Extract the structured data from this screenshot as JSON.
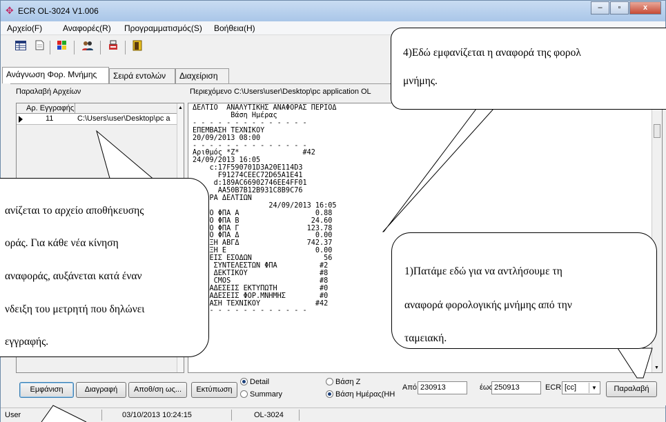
{
  "window": {
    "title": "ECR OL-3024 V1.006",
    "controls": [
      "–",
      "▫",
      "x"
    ]
  },
  "menu": [
    "Αρχείο(F)",
    "Αναφορές(R)",
    "Προγραμματισμός(S)",
    "Βοήθεια(H)"
  ],
  "tabs": [
    "Ανάγνωση Φορ. Μνήμης",
    "Σειρά εντολών",
    "Διαχείριση"
  ],
  "left": {
    "label": "Παραλαβή Αρχείων",
    "columns": [
      "Αρ. Εγγραφής",
      ""
    ],
    "rows": [
      {
        "num": "11",
        "path": "C:\\Users\\user\\Desktop\\pc a"
      }
    ]
  },
  "right": {
    "label": "Περιεχόμενο   C:\\Users\\user\\Desktop\\pc application OL",
    "report": "ΔΕΛΤΙΟ  ΑΝΑΛΥΤΙΚΗΣ ΑΝΑΦΟΡΑΣ ΠΕΡΙΟΔ\n         Βάση Ημέρας\n- - - - - - - - - - - - - -\nΕΠΕΜΒΑΣΗ ΤΕΧΝΙΚΟΥ\n20/09/2013 08:00\n- - - - - - - - - - - - - -\nΑριθμός *Ζ*               #42\n24/09/2013 16:05\n    c:17F590701D3A20E114D3\n      F91274CEEC72D65A1E41\n     d:189AC66902746EE4FF01\n      AA50B7B12B931C8B9C76\n   ΟΡΑ ΔΕΛΤΙΩΝ\n                  24/09/2013 16:05\n   ΤΟ ΦΠΑ Α                  0.88\n   ΤΟ ΦΠΑ Β                 24.60\n   ΤΟ ΦΠΑ Γ                123.78\n   ΤΟ ΦΠΑ Δ                  0.00\n   ΑΞΗ ΑΒΓΔ                742.37\n   ΑΞΗ Ε                     0.00\n   ΞΕΙΣ ΕΣΟΔΩΝ                 56\n   Η ΣΥΝΤΕΛΕΣΤΩΝ ΦΠΑ          #2\n   Η ΔΕΚΤΙΚΟΥ                 #8\n   Η CMOS                     #8\n   ΝΑΔΕΣΕΙΣ ΕΚΤΥΠΩΤΗ          #0\n   ΝΑΔΕΣΕΙΣ ΦΟΡ.ΜΝΗΜΗΣ        #0\n   ΒΑΣΗ ΤΕΧΝΙΚΟΥ             #42\n- - - - - - - - - - - - - -"
  },
  "bottom": {
    "show": "Εμφάνιση",
    "delete": "Διαγραφή",
    "save_as": "Αποθ/ση ως...",
    "print": "Εκτύπωση",
    "detail": "Detail",
    "summary": "Summary",
    "basis_z": "Βάση Ζ",
    "basis_day": "Βάση Ημέρας(ΗΗ",
    "from_label": "Από",
    "from_value": "230913",
    "to_label": "έως",
    "to_value": "250913",
    "ecr_label": "ECR",
    "ecr_value": "[cc]",
    "receive": "Παραλαβή"
  },
  "status": [
    "User",
    "03/10/2013 10:24:15",
    "OL-3024"
  ],
  "callouts": {
    "top_right": [
      "4)Εδώ εμφανίζεται η αναφορά της φορολ",
      "μνήμης."
    ],
    "left": [
      "ανίζεται το αρχείο αποθήκευσης",
      "οράς.  Για  κάθε  νέα  κίνηση",
      "αναφοράς,  αυξάνεται  κατά  έναν",
      "νδειξη του μετρητή που δηλώνει",
      "εγγραφής."
    ],
    "bottom_right": [
      "1)Πατάμε εδώ για να αντλήσουμε τη",
      "αναφορά φορολογικής μνήμης από την",
      "ταμειακή."
    ]
  }
}
